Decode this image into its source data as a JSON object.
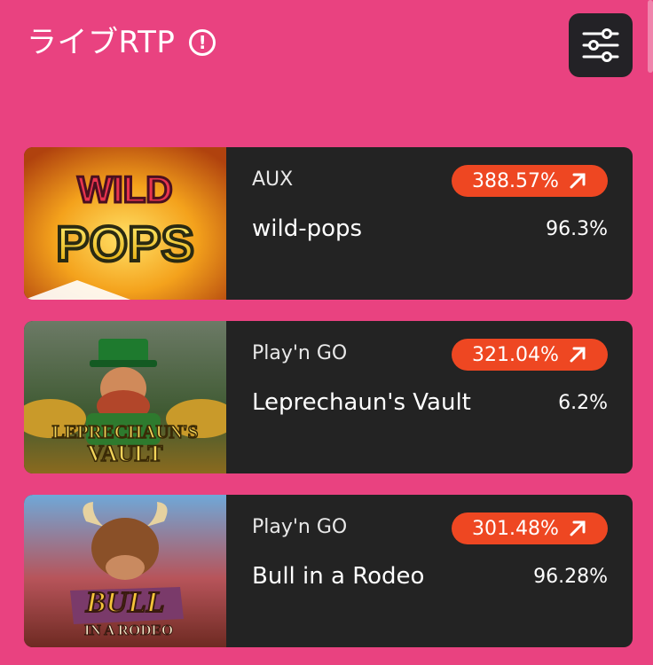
{
  "header": {
    "title": "ライブRTP",
    "info_icon": "info-circle-icon",
    "filter_icon": "sliders-icon"
  },
  "colors": {
    "background": "#E94280",
    "card": "#232323",
    "badge": "#EE4722",
    "filter_button": "#232226"
  },
  "games": [
    {
      "provider": "AUX",
      "badge": "388.57%",
      "name": "wild-pops",
      "rtp": "96.3%",
      "thumbnail_text": [
        "WILD",
        "POPS"
      ]
    },
    {
      "provider": "Play'n GO",
      "badge": "321.04%",
      "name": "Leprechaun's Vault",
      "rtp": "6.2%",
      "thumbnail_text": [
        "LEPRECHAUN'S",
        "VAULT"
      ]
    },
    {
      "provider": "Play'n GO",
      "badge": "301.48%",
      "name": "Bull in a Rodeo",
      "rtp": "96.28%",
      "thumbnail_text": [
        "BULL",
        "IN A RODEO"
      ]
    }
  ]
}
